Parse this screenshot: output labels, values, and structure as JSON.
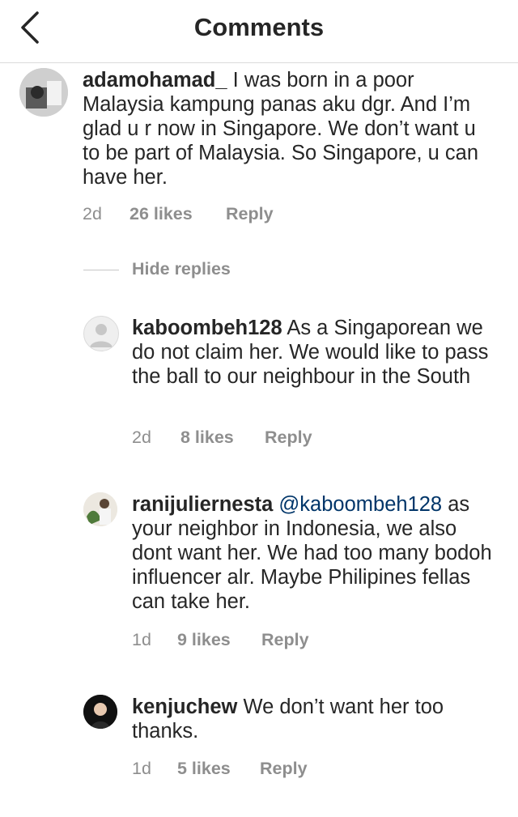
{
  "header": {
    "title": "Comments",
    "back_icon": "chevron-left-icon"
  },
  "comments": [
    {
      "username": "adamohamad_",
      "text": " I was born in a poor Malaysia kampung panas aku dgr. And I’m glad u r now in Singapore. We don’t want u to be part of Malaysia. So Singapore, u can have her.",
      "time": "2d",
      "likes": "26 likes",
      "reply": "Reply"
    }
  ],
  "hide_replies": "Hide replies",
  "replies": [
    {
      "username": "kaboombeh128",
      "mention": "",
      "text": " As a Singaporean we do not claim her. We would like to pass the ball to our neighbour in the South",
      "time": "2d",
      "likes": "8 likes",
      "reply": "Reply"
    },
    {
      "username": "ranijuliernesta",
      "mention": " @kaboombeh128",
      "text": " as your neighbor in Indonesia, we also dont want her. We had too many bodoh influencer alr. Maybe Philipines fellas can take her.",
      "time": "1d",
      "likes": "9 likes",
      "reply": "Reply"
    },
    {
      "username": "kenjuchew",
      "mention": "",
      "text": " We don’t want her too thanks.",
      "time": "1d",
      "likes": "5 likes",
      "reply": "Reply"
    }
  ]
}
